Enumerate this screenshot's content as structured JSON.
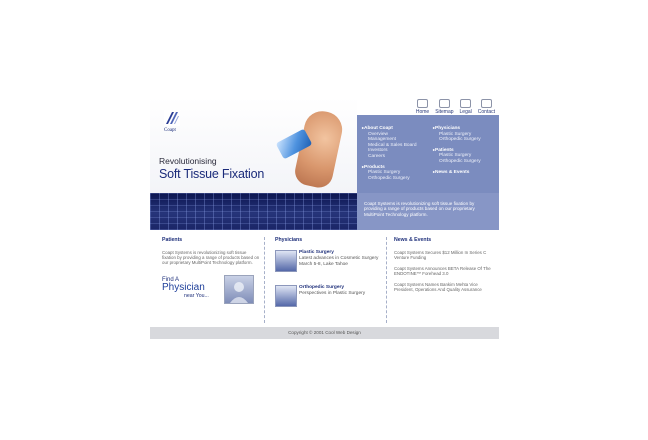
{
  "topnav": [
    {
      "label": "Home",
      "icon": "home-icon"
    },
    {
      "label": "Sitemap",
      "icon": "sitemap-icon"
    },
    {
      "label": "Legal",
      "icon": "legal-icon"
    },
    {
      "label": "Contact",
      "icon": "contact-icon"
    }
  ],
  "brand": {
    "logo_text": "Coapt"
  },
  "hero": {
    "tagline_small": "Revolutionising",
    "tagline_large": "Soft Tissue Fixation"
  },
  "menu": {
    "about": {
      "title": "About Coapt",
      "items": [
        "Overview",
        "Management",
        "Medical & Sales Board",
        "Investors",
        "Careers"
      ]
    },
    "products": {
      "title": "Products",
      "items": [
        "Plastic Surgery",
        "Orthopedic Surgery"
      ]
    },
    "physicians": {
      "title": "Physicians",
      "items": [
        "Plastic Surgery",
        "Orthopedic Surgery"
      ]
    },
    "patients": {
      "title": "Patients",
      "items": [
        "Plastic Surgery",
        "Orthopedic Surgery"
      ]
    },
    "news": {
      "title": "News & Events"
    }
  },
  "intro": "Coapt Systems is revolutionizing soft tissue fixation by providing a range of products based on our proprietary MultiPoint Technology platform.",
  "patients": {
    "title": "Patients",
    "text": "Coapt Systems is revolutionizing soft tissue fixation by providing a range of products based on our proprietary MultiPoint Technology platform.",
    "find_small": "Find A",
    "find_big": "Physician",
    "find_near": "near You..."
  },
  "physicians": {
    "title": "Physicians",
    "items": [
      {
        "title": "Plastic Surgery",
        "desc": "Latest advances in Cosmetic Surgery March 5-8, Lake Tahoe"
      },
      {
        "title": "Orthopedic Surgery",
        "desc": "Perspectives in Plastic Surgery"
      }
    ]
  },
  "news": {
    "title": "News & Events",
    "items": [
      "Coapt Systems Secures $12 Million In Series C Venture Funding",
      "Coapt Systems Announces BETA Release Of The ENDOTINE™ Forehead 3.0",
      "Coapt Systems Names Bankim Mehta Vice President, Operations And Quality Assurance"
    ]
  },
  "footer": "Copyright © 2001 Cool Web Design"
}
